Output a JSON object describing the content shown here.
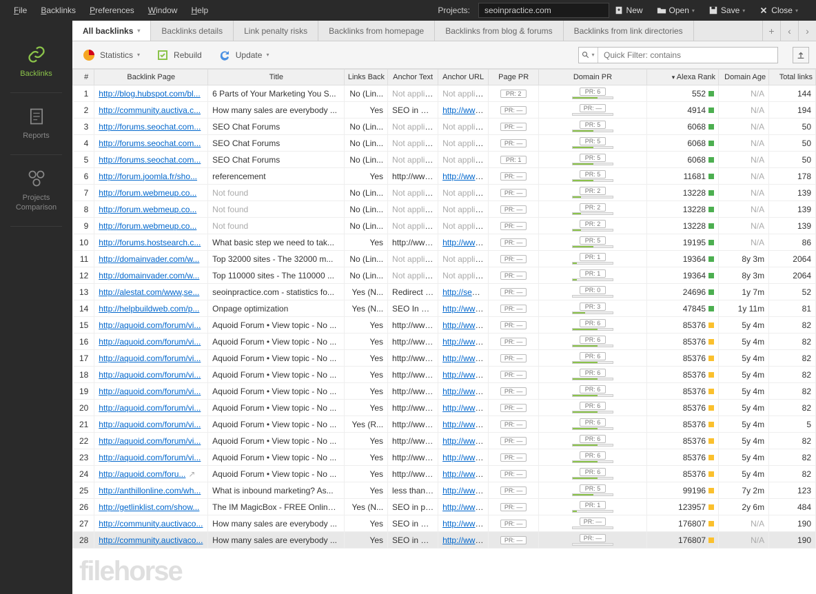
{
  "menu": {
    "items": [
      "File",
      "Backlinks",
      "Preferences",
      "Window",
      "Help"
    ],
    "projects_label": "Projects:",
    "project_selected": "seoinpractice.com",
    "buttons": {
      "new": "New",
      "open": "Open",
      "save": "Save",
      "close": "Close"
    }
  },
  "sidebar": {
    "items": [
      {
        "label": "Backlinks",
        "active": true
      },
      {
        "label": "Reports",
        "active": false
      },
      {
        "label": "Projects Comparison",
        "active": false
      }
    ]
  },
  "tabs": {
    "items": [
      {
        "label": "All backlinks",
        "active": true,
        "dropdown": true
      },
      {
        "label": "Backlinks details",
        "active": false
      },
      {
        "label": "Link penalty risks",
        "active": false
      },
      {
        "label": "Backlinks from homepage",
        "active": false
      },
      {
        "label": "Backlinks from blog & forums",
        "active": false
      },
      {
        "label": "Backlinks from link directories",
        "active": false
      }
    ]
  },
  "subbar": {
    "statistics": "Statistics",
    "rebuild": "Rebuild",
    "update": "Update",
    "filter_placeholder": "Quick Filter: contains"
  },
  "columns": [
    "#",
    "Backlink Page",
    "Title",
    "Links Back",
    "Anchor Text",
    "Anchor URL",
    "Page PR",
    "Domain PR",
    "Alexa Rank",
    "Domain Age",
    "Total links"
  ],
  "sorted_column": "Alexa Rank",
  "rows": [
    {
      "n": 1,
      "page": "http://blog.hubspot.com/bl...",
      "title": "6 Parts of Your Marketing You S...",
      "lback": "No (Lin...",
      "atext": "Not applic...",
      "atext_na": true,
      "aurl": "Not applic...",
      "aurl_na": true,
      "ppr": "PR: 2",
      "dpr": "PR: 6",
      "dprv": 6,
      "alexa": 552,
      "ac": "green",
      "age": "N/A",
      "total": 144
    },
    {
      "n": 2,
      "page": "http://community.auctiva.c...",
      "title": "How many sales are everybody ...",
      "lback": "Yes",
      "atext": "SEO in Pr...",
      "aurl": "http://www...",
      "aurl_link": true,
      "ppr": "PR: —",
      "dpr": "PR: —",
      "dprv": 0,
      "alexa": 4914,
      "ac": "green",
      "age": "N/A",
      "total": 194
    },
    {
      "n": 3,
      "page": "http://forums.seochat.com...",
      "title": "SEO Chat Forums",
      "lback": "No (Lin...",
      "atext": "Not applic...",
      "atext_na": true,
      "aurl": "Not applic...",
      "aurl_na": true,
      "ppr": "PR: —",
      "dpr": "PR: 5",
      "dprv": 5,
      "alexa": 6068,
      "ac": "green",
      "age": "N/A",
      "total": 50
    },
    {
      "n": 4,
      "page": "http://forums.seochat.com...",
      "title": "SEO Chat Forums",
      "lback": "No (Lin...",
      "atext": "Not applic...",
      "atext_na": true,
      "aurl": "Not applic...",
      "aurl_na": true,
      "ppr": "PR: —",
      "dpr": "PR: 5",
      "dprv": 5,
      "alexa": 6068,
      "ac": "green",
      "age": "N/A",
      "total": 50
    },
    {
      "n": 5,
      "page": "http://forums.seochat.com...",
      "title": "SEO Chat Forums",
      "lback": "No (Lin...",
      "atext": "Not applic...",
      "atext_na": true,
      "aurl": "Not applic...",
      "aurl_na": true,
      "ppr": "PR: 1",
      "dpr": "PR: 5",
      "dprv": 5,
      "alexa": 6068,
      "ac": "green",
      "age": "N/A",
      "total": 50
    },
    {
      "n": 6,
      "page": "http://forum.joomla.fr/sho...",
      "title": "referencement",
      "lback": "Yes",
      "atext": "http://www...",
      "aurl": "http://www...",
      "aurl_link": true,
      "ppr": "PR: —",
      "dpr": "PR: 5",
      "dprv": 5,
      "alexa": 11681,
      "ac": "green",
      "age": "N/A",
      "total": 178
    },
    {
      "n": 7,
      "page": "http://forum.webmeup.co...",
      "title": "Not found",
      "title_na": true,
      "lback": "No (Lin...",
      "atext": "Not applic...",
      "atext_na": true,
      "aurl": "Not applic...",
      "aurl_na": true,
      "ppr": "PR: —",
      "dpr": "PR: 2",
      "dprv": 2,
      "alexa": 13228,
      "ac": "green",
      "age": "N/A",
      "total": 139
    },
    {
      "n": 8,
      "page": "http://forum.webmeup.co...",
      "title": "Not found",
      "title_na": true,
      "lback": "No (Lin...",
      "atext": "Not applic...",
      "atext_na": true,
      "aurl": "Not applic...",
      "aurl_na": true,
      "ppr": "PR: —",
      "dpr": "PR: 2",
      "dprv": 2,
      "alexa": 13228,
      "ac": "green",
      "age": "N/A",
      "total": 139
    },
    {
      "n": 9,
      "page": "http://forum.webmeup.co...",
      "title": "Not found",
      "title_na": true,
      "lback": "No (Lin...",
      "atext": "Not applic...",
      "atext_na": true,
      "aurl": "Not applic...",
      "aurl_na": true,
      "ppr": "PR: —",
      "dpr": "PR: 2",
      "dprv": 2,
      "alexa": 13228,
      "ac": "green",
      "age": "N/A",
      "total": 139
    },
    {
      "n": 10,
      "page": "http://forums.hostsearch.c...",
      "title": "What basic step we need to tak...",
      "lback": "Yes",
      "atext": "http://www...",
      "aurl": "http://www...",
      "aurl_link": true,
      "ppr": "PR: —",
      "dpr": "PR: 5",
      "dprv": 5,
      "alexa": 19195,
      "ac": "green",
      "age": "N/A",
      "total": 86
    },
    {
      "n": 11,
      "page": "http://domainvader.com/w...",
      "title": "Top 32000 sites - The 32000 m...",
      "lback": "No (Lin...",
      "atext": "Not applic...",
      "atext_na": true,
      "aurl": "Not applic...",
      "aurl_na": true,
      "ppr": "PR: —",
      "dpr": "PR: 1",
      "dprv": 1,
      "alexa": 19364,
      "ac": "green",
      "age": "8y 3m",
      "total": 2064
    },
    {
      "n": 12,
      "page": "http://domainvader.com/w...",
      "title": "Top 110000 sites - The 110000 ...",
      "lback": "No (Lin...",
      "atext": "Not applic...",
      "atext_na": true,
      "aurl": "Not applic...",
      "aurl_na": true,
      "ppr": "PR: —",
      "dpr": "PR: 1",
      "dprv": 1,
      "alexa": 19364,
      "ac": "green",
      "age": "8y 3m",
      "total": 2064
    },
    {
      "n": 13,
      "page": "http://alestat.com/www,se...",
      "title": "seoinpractice.com - statistics fo...",
      "lback": "Yes (N...",
      "atext": "Redirect t...",
      "aurl": "http://seoi...",
      "aurl_link": true,
      "ppr": "PR: —",
      "dpr": "PR: 0",
      "dprv": 0,
      "alexa": 24696,
      "ac": "green",
      "age": "1y 7m",
      "total": 52
    },
    {
      "n": 14,
      "page": "http://helpbuildweb.com/p...",
      "title": "Onpage optimization",
      "lback": "Yes (N...",
      "atext": "SEO In Pr...",
      "aurl": "http://www...",
      "aurl_link": true,
      "ppr": "PR: —",
      "dpr": "PR: 3",
      "dprv": 3,
      "alexa": 47845,
      "ac": "green",
      "age": "1y 11m",
      "total": 81
    },
    {
      "n": 15,
      "page": "http://aquoid.com/forum/vi...",
      "title": "Aquoid Forum • View topic - No ...",
      "lback": "Yes",
      "atext": "http://www...",
      "aurl": "http://www...",
      "aurl_link": true,
      "ppr": "PR: —",
      "dpr": "PR: 6",
      "dprv": 6,
      "alexa": 85376,
      "ac": "yellow",
      "age": "5y 4m",
      "total": 82
    },
    {
      "n": 16,
      "page": "http://aquoid.com/forum/vi...",
      "title": "Aquoid Forum • View topic - No ...",
      "lback": "Yes",
      "atext": "http://www...",
      "aurl": "http://www...",
      "aurl_link": true,
      "ppr": "PR: —",
      "dpr": "PR: 6",
      "dprv": 6,
      "alexa": 85376,
      "ac": "yellow",
      "age": "5y 4m",
      "total": 82
    },
    {
      "n": 17,
      "page": "http://aquoid.com/forum/vi...",
      "title": "Aquoid Forum • View topic - No ...",
      "lback": "Yes",
      "atext": "http://www...",
      "aurl": "http://www...",
      "aurl_link": true,
      "ppr": "PR: —",
      "dpr": "PR: 6",
      "dprv": 6,
      "alexa": 85376,
      "ac": "yellow",
      "age": "5y 4m",
      "total": 82
    },
    {
      "n": 18,
      "page": "http://aquoid.com/forum/vi...",
      "title": "Aquoid Forum • View topic - No ...",
      "lback": "Yes",
      "atext": "http://www...",
      "aurl": "http://www...",
      "aurl_link": true,
      "ppr": "PR: —",
      "dpr": "PR: 6",
      "dprv": 6,
      "alexa": 85376,
      "ac": "yellow",
      "age": "5y 4m",
      "total": 82
    },
    {
      "n": 19,
      "page": "http://aquoid.com/forum/vi...",
      "title": "Aquoid Forum • View topic - No ...",
      "lback": "Yes",
      "atext": "http://www...",
      "aurl": "http://www...",
      "aurl_link": true,
      "ppr": "PR: —",
      "dpr": "PR: 6",
      "dprv": 6,
      "alexa": 85376,
      "ac": "yellow",
      "age": "5y 4m",
      "total": 82
    },
    {
      "n": 20,
      "page": "http://aquoid.com/forum/vi...",
      "title": "Aquoid Forum • View topic - No ...",
      "lback": "Yes",
      "atext": "http://www...",
      "aurl": "http://www...",
      "aurl_link": true,
      "ppr": "PR: —",
      "dpr": "PR: 6",
      "dprv": 6,
      "alexa": 85376,
      "ac": "yellow",
      "age": "5y 4m",
      "total": 82
    },
    {
      "n": 21,
      "page": "http://aquoid.com/forum/vi...",
      "title": "Aquoid Forum • View topic - No ...",
      "lback": "Yes (R...",
      "atext": "http://www...",
      "aurl": "http://www...",
      "aurl_link": true,
      "ppr": "PR: —",
      "dpr": "PR: 6",
      "dprv": 6,
      "alexa": 85376,
      "ac": "yellow",
      "age": "5y 4m",
      "total": 5
    },
    {
      "n": 22,
      "page": "http://aquoid.com/forum/vi...",
      "title": "Aquoid Forum • View topic - No ...",
      "lback": "Yes",
      "atext": "http://www...",
      "aurl": "http://www...",
      "aurl_link": true,
      "ppr": "PR: —",
      "dpr": "PR: 6",
      "dprv": 6,
      "alexa": 85376,
      "ac": "yellow",
      "age": "5y 4m",
      "total": 82
    },
    {
      "n": 23,
      "page": "http://aquoid.com/forum/vi...",
      "title": "Aquoid Forum • View topic - No ...",
      "lback": "Yes",
      "atext": "http://www...",
      "aurl": "http://www...",
      "aurl_link": true,
      "ppr": "PR: —",
      "dpr": "PR: 6",
      "dprv": 6,
      "alexa": 85376,
      "ac": "yellow",
      "age": "5y 4m",
      "total": 82
    },
    {
      "n": 24,
      "page": "http://aquoid.com/foru...",
      "ext": true,
      "title": "Aquoid Forum • View topic - No ...",
      "lback": "Yes",
      "atext": "http://www...",
      "aurl": "http://www...",
      "aurl_link": true,
      "ppr": "PR: —",
      "dpr": "PR: 6",
      "dprv": 6,
      "alexa": 85376,
      "ac": "yellow",
      "age": "5y 4m",
      "total": 82
    },
    {
      "n": 25,
      "page": "http://anthillonline.com/wh...",
      "title": "What is inbound marketing? As...",
      "lback": "Yes",
      "atext": "less than ...",
      "aurl": "http://www...",
      "aurl_link": true,
      "ppr": "PR: —",
      "dpr": "PR: 5",
      "dprv": 5,
      "alexa": 99196,
      "ac": "yellow",
      "age": "7y 2m",
      "total": 123
    },
    {
      "n": 26,
      "page": "http://getlinklist.com/show...",
      "title": "The IM MagicBox - FREE Online ...",
      "lback": "Yes (N...",
      "atext": "SEO in pr...",
      "aurl": "http://www...",
      "aurl_link": true,
      "ppr": "PR: —",
      "dpr": "PR: 1",
      "dprv": 1,
      "alexa": 123957,
      "ac": "yellow",
      "age": "2y 6m",
      "total": 484
    },
    {
      "n": 27,
      "page": "http://community.auctivaco...",
      "title": "How many sales are everybody ...",
      "lback": "Yes",
      "atext": "SEO in Pr...",
      "aurl": "http://www...",
      "aurl_link": true,
      "ppr": "PR: —",
      "dpr": "PR: —",
      "dprv": 0,
      "alexa": 176807,
      "ac": "yellow",
      "age": "N/A",
      "total": 190
    },
    {
      "n": 28,
      "page": "http://community.auctivaco...",
      "title": "How many sales are everybody ...",
      "lback": "Yes",
      "atext": "SEO in Pr...",
      "aurl": "http://www...",
      "aurl_link": true,
      "ppr": "PR: —",
      "dpr": "PR: —",
      "dprv": 0,
      "alexa": 176807,
      "ac": "yellow",
      "age": "N/A",
      "total": 190,
      "selected": true
    }
  ],
  "watermark": "filehorse"
}
